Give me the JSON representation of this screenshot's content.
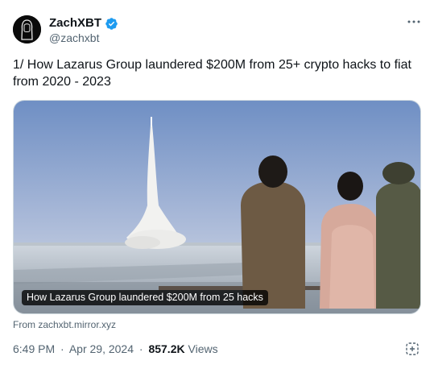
{
  "author": {
    "name": "ZachXBT",
    "handle": "@zachxbt",
    "verified_color": "#1d9bf0",
    "avatar_icon": "hooded-figure-avatar"
  },
  "tweet": {
    "line1": "1/ How Lazarus Group laundered $200M from 25+ crypto hacks to fiat",
    "line2": "from 2020 - 2023"
  },
  "card": {
    "caption": "How Lazarus Group laundered $200M from 25 hacks",
    "source": "From zachxbt.mirror.xyz",
    "image_icon": "missile-launch-photo"
  },
  "meta": {
    "time": "6:49 PM",
    "date": "Apr 29, 2024",
    "views_count": "857.2K",
    "views_label": "Views",
    "separator": "·"
  },
  "icons": {
    "more": "more-options-icon",
    "grok": "grok-analyze-icon"
  }
}
